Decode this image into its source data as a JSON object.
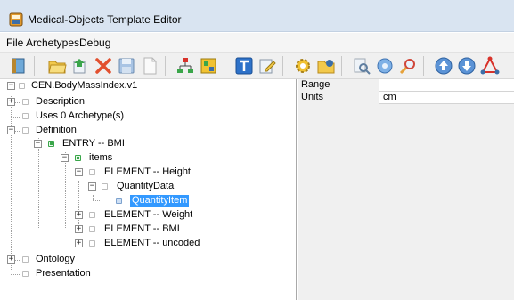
{
  "window": {
    "title": "Medical-Objects Template Editor"
  },
  "menu": {
    "items": [
      "File",
      "Archetypes",
      "Debug"
    ]
  },
  "toolbar": {
    "buttons": [
      "book-icon",
      "open-folder-icon",
      "import-icon",
      "delete-icon",
      "save-icon",
      "new-document-icon",
      "hierarchy-icon",
      "network-icon",
      "text-icon",
      "edit-icon",
      "gear-icon",
      "folder-edit-icon",
      "search-document-icon",
      "circle-icon",
      "magnify-icon",
      "up-arrow-icon",
      "down-arrow-icon",
      "triangle-nodes-icon"
    ]
  },
  "tree": {
    "nodes": [
      {
        "label": "CEN.BodyMassIndex.v1"
      },
      {
        "label": "Description"
      },
      {
        "label": "Uses 0 Archetype(s)"
      },
      {
        "label": "Definition"
      },
      {
        "label": "ENTRY -- BMI"
      },
      {
        "label": "items"
      },
      {
        "label": "ELEMENT -- Height"
      },
      {
        "label": "QuantityData"
      },
      {
        "label": "QuantityItem"
      },
      {
        "label": "ELEMENT -- Weight"
      },
      {
        "label": "ELEMENT -- BMI"
      },
      {
        "label": "ELEMENT -- uncoded"
      },
      {
        "label": "Ontology"
      },
      {
        "label": "Presentation"
      }
    ]
  },
  "properties": {
    "rows": [
      {
        "key": "Range",
        "value": ""
      },
      {
        "key": "Units",
        "value": "cm"
      }
    ]
  },
  "colors": {
    "titlebar": "#d9e4f1",
    "selection": "#3399ff",
    "entry_icon": "#3aa64a"
  }
}
